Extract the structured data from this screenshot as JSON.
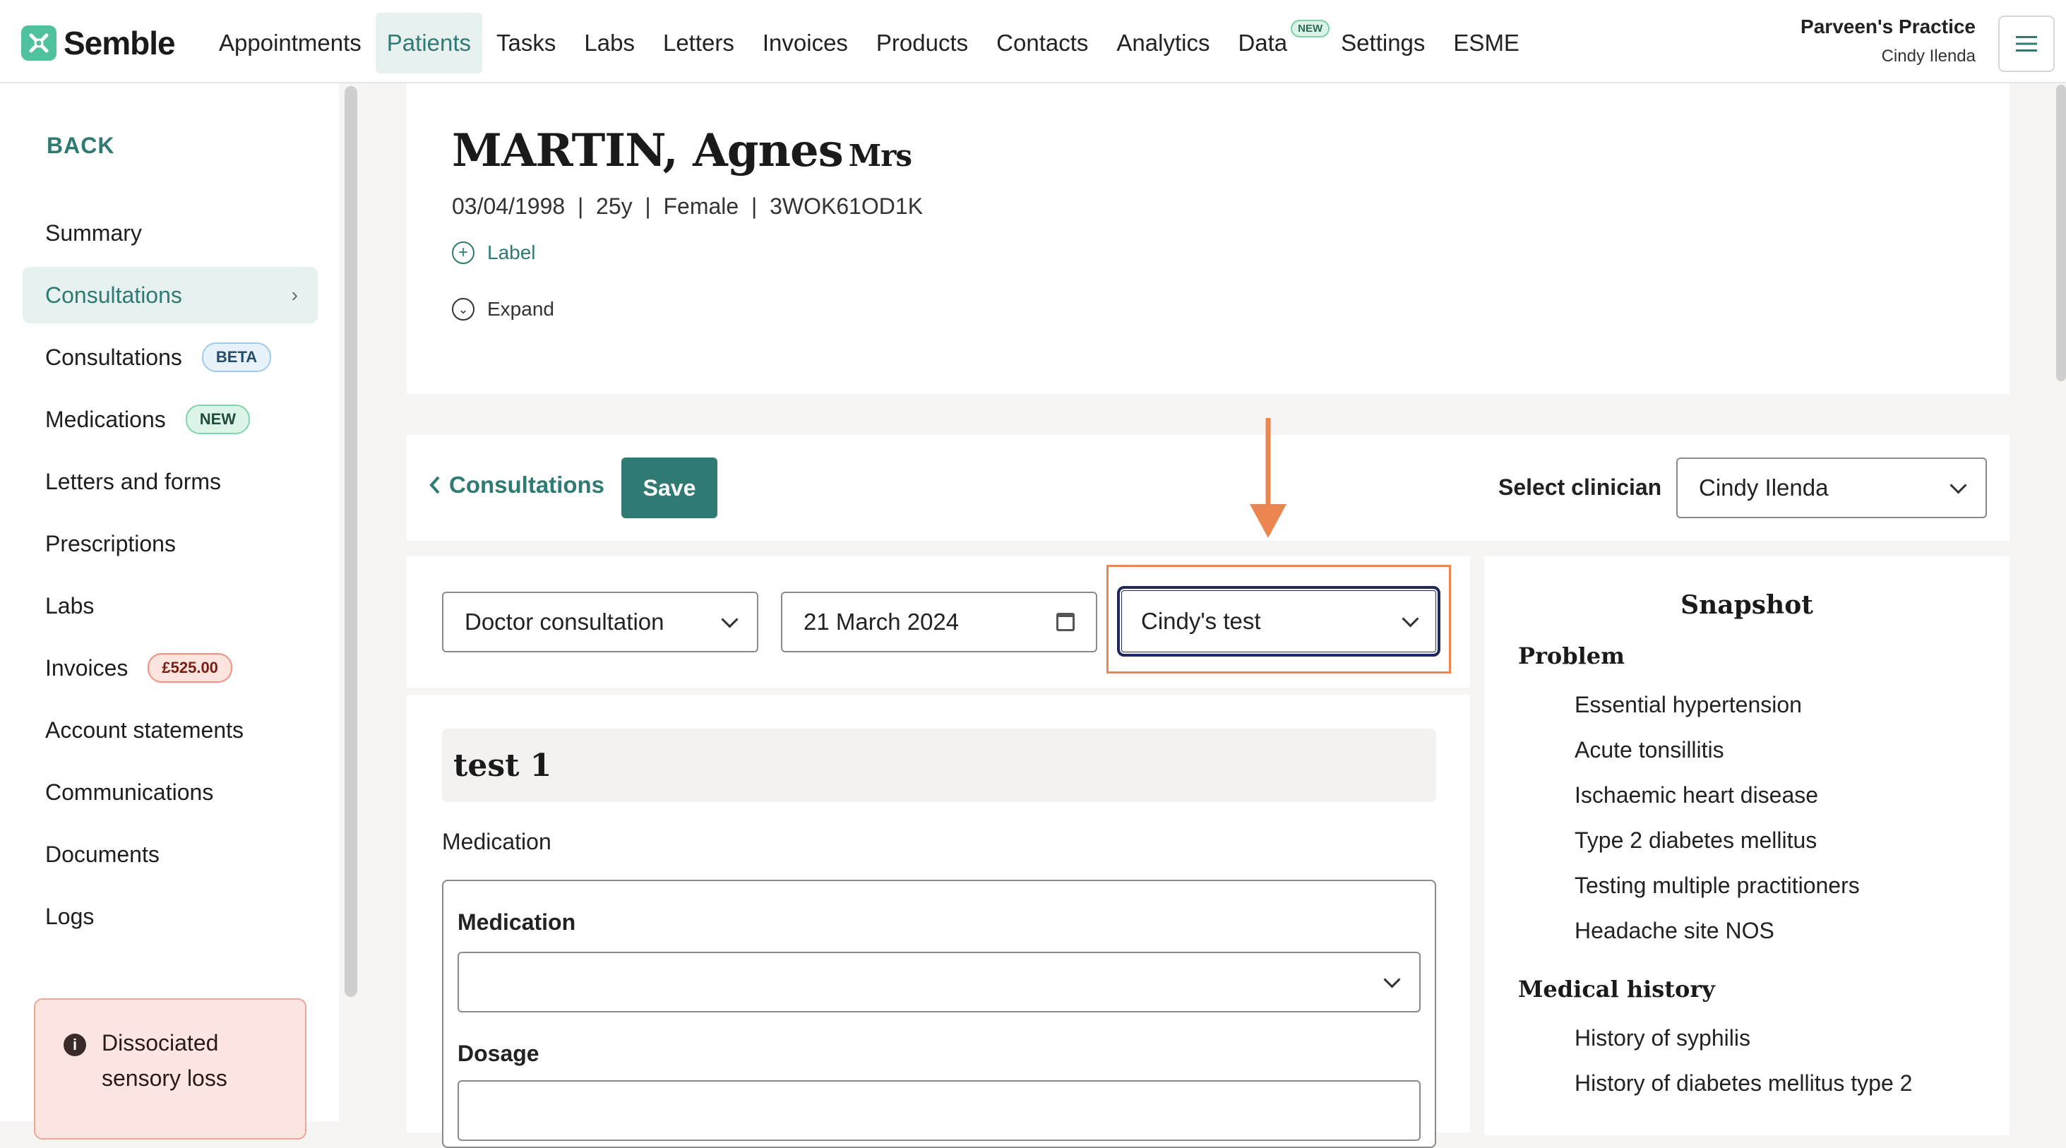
{
  "brand": {
    "name": "Semble"
  },
  "nav": {
    "items": [
      "Appointments",
      "Patients",
      "Tasks",
      "Labs",
      "Letters",
      "Invoices",
      "Products",
      "Contacts",
      "Analytics",
      "Data",
      "Settings",
      "ESME"
    ],
    "active": "Patients",
    "data_badge": "NEW"
  },
  "practice": {
    "name": "Parveen's Practice",
    "user": "Cindy Ilenda"
  },
  "sidebar": {
    "back": "BACK",
    "items": [
      {
        "label": "Summary"
      },
      {
        "label": "Consultations"
      },
      {
        "label": "Consultations",
        "badge": "BETA"
      },
      {
        "label": "Medications",
        "badge": "NEW"
      },
      {
        "label": "Letters and forms"
      },
      {
        "label": "Prescriptions"
      },
      {
        "label": "Labs"
      },
      {
        "label": "Invoices",
        "badge": "£525.00"
      },
      {
        "label": "Account statements"
      },
      {
        "label": "Communications"
      },
      {
        "label": "Documents"
      },
      {
        "label": "Logs"
      }
    ],
    "alert": "Dissociated sensory loss"
  },
  "patient": {
    "name": "MARTIN, Agnes",
    "title": "Mrs",
    "details": "03/04/1998  |  25y  |  Female  |  3WOK61OD1K",
    "label_action": "Label",
    "expand_action": "Expand"
  },
  "toolbar": {
    "back_label": "Consultations",
    "save_label": "Save",
    "clinician_label": "Select clinician",
    "clinician_value": "Cindy Ilenda"
  },
  "form": {
    "type": "Doctor consultation",
    "date": "21 March 2024",
    "template": "Cindy's test",
    "section_title": "test 1",
    "medication_section": "Medication",
    "medication_field": "Medication",
    "dosage_field": "Dosage"
  },
  "snapshot": {
    "title": "Snapshot",
    "problem_heading": "Problem",
    "problems": [
      "Essential hypertension",
      "Acute tonsillitis",
      "Ischaemic heart disease",
      "Type 2 diabetes mellitus",
      "Testing multiple practitioners",
      "Headache site NOS"
    ],
    "history_heading": "Medical history",
    "history": [
      "History of syphilis",
      "History of diabetes mellitus type 2"
    ]
  },
  "colors": {
    "accent": "#2f7b74",
    "highlight": "#ec8650",
    "brand": "#4fc19c"
  }
}
